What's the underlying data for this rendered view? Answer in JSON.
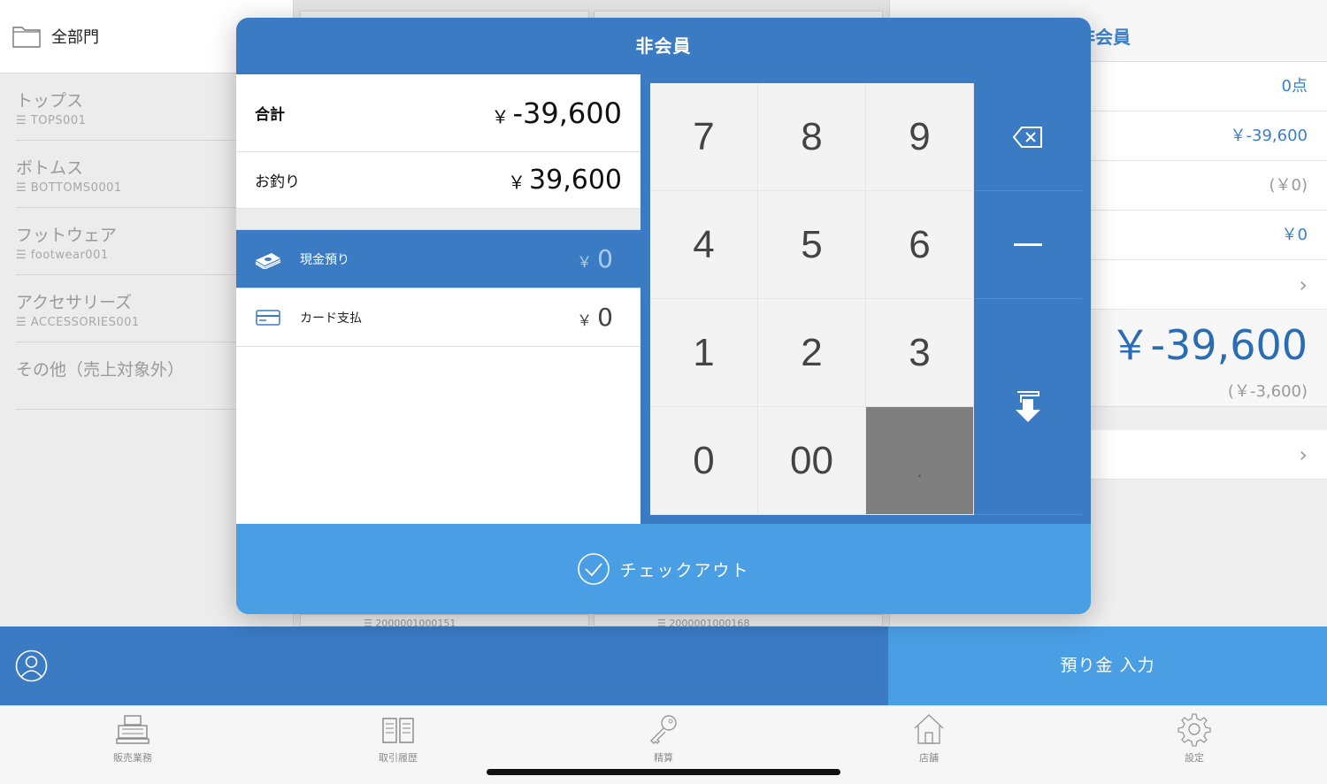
{
  "sidebar": {
    "header_label": "全部門",
    "categories": [
      {
        "name": "トップス",
        "code": "☰ TOPS001"
      },
      {
        "name": "ボトムス",
        "code": "☰ BOTTOMS0001"
      },
      {
        "name": "フットウェア",
        "code": "☰ footwear001"
      },
      {
        "name": "アクセサリーズ",
        "code": "☰ ACCESSORIES001"
      },
      {
        "name": "その他（売上対象外）",
        "code": ""
      }
    ]
  },
  "grid": {
    "codes": [
      "☰ 2000001000151",
      "☰ 2000001000168"
    ]
  },
  "order_panel": {
    "title": "非会員",
    "quantity": "0点",
    "subtotal": "￥-39,600",
    "tax": "(￥0)",
    "discount": "￥0",
    "total": "￥-39,600",
    "total_tax": "(￥-3,600)"
  },
  "modal": {
    "title": "非会員",
    "total_label": "合計",
    "total_currency": "￥",
    "total_value": "-39,600",
    "change_label": "お釣り",
    "change_currency": "￥",
    "change_value": "39,600",
    "payments": [
      {
        "label": "現金預り",
        "currency": "￥",
        "value": "0",
        "icon": "cash-icon",
        "active": true
      },
      {
        "label": "カード支払",
        "currency": "￥",
        "value": "0",
        "icon": "card-icon",
        "active": false
      }
    ],
    "keys": [
      "7",
      "8",
      "9",
      "4",
      "5",
      "6",
      "1",
      "2",
      "3",
      "0",
      "00",
      "."
    ],
    "checkout_label": "チェックアウト"
  },
  "actionbar": {
    "deposit_label": "預り金 入力"
  },
  "tabs": [
    {
      "label": "販売業務",
      "icon": "register-icon"
    },
    {
      "label": "取引履歴",
      "icon": "history-icon"
    },
    {
      "label": "精算",
      "icon": "key-icon"
    },
    {
      "label": "店舗",
      "icon": "store-icon"
    },
    {
      "label": "設定",
      "icon": "gear-icon"
    }
  ],
  "colors": {
    "primary": "#3a7bc4",
    "accent": "#4a9ee4",
    "key_disabled": "#7f7f7f"
  }
}
